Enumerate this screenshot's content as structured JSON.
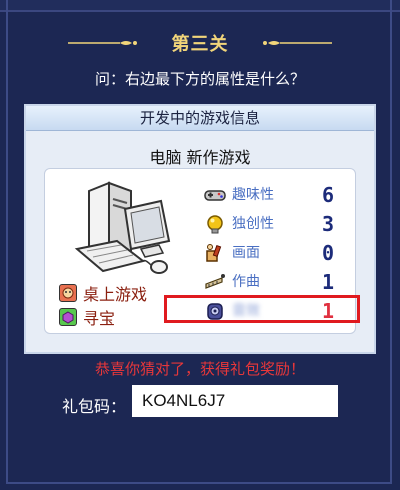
{
  "header": {
    "level_title": "第三关",
    "question": "问：右边最下方的属性是什么？"
  },
  "panel": {
    "title": "开发中的游戏信息",
    "game_name": "电脑 新作游戏",
    "genres": [
      {
        "label": "桌上游戏",
        "icon": "board-game-icon",
        "color": "#e05a3a"
      },
      {
        "label": "寻宝",
        "icon": "treasure-icon",
        "color": "#4fc04a"
      }
    ],
    "stats": [
      {
        "label": "趣味性",
        "value": "6",
        "icon": "gamepad-icon"
      },
      {
        "label": "独创性",
        "value": "3",
        "icon": "lightbulb-icon"
      },
      {
        "label": "画面",
        "value": "0",
        "icon": "paintbrush-icon"
      },
      {
        "label": "作曲",
        "value": "1",
        "icon": "music-icon"
      },
      {
        "label": "音效",
        "value": "1",
        "icon": "speaker-icon",
        "obscured": true
      }
    ]
  },
  "result": {
    "congrats": "恭喜你猜对了，获得礼包奖励！",
    "code_label": "礼包码：",
    "code_value": "KO4NL6J7"
  },
  "colors": {
    "background": "#1c2753",
    "title_gold": "#f1d57a",
    "stat_value": "#1c2b7a",
    "highlight": "#e01a1f",
    "congrats": "#e8373a"
  }
}
